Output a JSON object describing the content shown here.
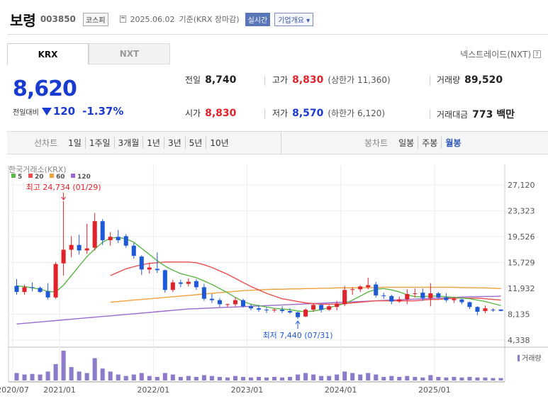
{
  "header": {
    "name": "보령",
    "code": "003850",
    "market": "코스피",
    "date": "2025.06.02",
    "basis": "기준(KRX 장마감)",
    "realtime": "실시간",
    "overview": "기업개요 ▾"
  },
  "tabs": [
    "KRX",
    "NXT"
  ],
  "nxt_link": "넥스트레이드(NXT)",
  "price": {
    "current": "8,620",
    "change_label": "전일대비",
    "change": "120",
    "change_pct": "-1.37%"
  },
  "stats": {
    "prev_label": "전일",
    "prev": "8,740",
    "high_label": "고가",
    "high": "8,830",
    "upper_limit": "(상한가 11,360)",
    "volume_label": "거래량",
    "volume": "89,520",
    "open_label": "시가",
    "open": "8,830",
    "low_label": "저가",
    "low": "8,570",
    "lower_limit": "(하한가 6,120)",
    "value_label": "거래대금",
    "value": "773 백만"
  },
  "toolbar": {
    "line_label": "선차트",
    "line_items": [
      "1일",
      "1주일",
      "3개월",
      "1년",
      "3년",
      "5년",
      "10년"
    ],
    "candle_label": "봉차트",
    "candle_items": [
      "일봉",
      "주봉",
      "월봉"
    ],
    "active_candle": "월봉"
  },
  "colors": {
    "up": "#e0222a",
    "down": "#1f5ad6",
    "ma5": "#5cb848",
    "ma20": "#e8504f",
    "ma60": "#f0a23c",
    "ma120": "#9b6bd0",
    "volume": "#8b7bc9"
  },
  "chart_data": {
    "type": "candlestick",
    "source_label": "한국거래소(KRX)",
    "legend": [
      {
        "name": "5",
        "color": "#5cb848"
      },
      {
        "name": "20",
        "color": "#e8504f"
      },
      {
        "name": "60",
        "color": "#f0a23c"
      },
      {
        "name": "120",
        "color": "#9b6bd0"
      }
    ],
    "y_ticks": [
      "27,120",
      "23,323",
      "19,526",
      "15,729",
      "11,932",
      "8,135",
      "4,338"
    ],
    "ylim": [
      4338,
      27120
    ],
    "x_ticks": [
      "2020/07",
      "2021/01",
      "2022/01",
      "2023/01",
      "2024/01",
      "2025/01"
    ],
    "x_tick_index": [
      0,
      6,
      18,
      30,
      42,
      54
    ],
    "max_label": "최고 24,734 (01/29)",
    "max_index": 6,
    "max_value": 24734,
    "min_label": "최저 7,440 (07/31)",
    "min_index": 36,
    "min_value": 7440,
    "volume_label": "거래량",
    "candles": [
      {
        "o": 12300,
        "h": 13300,
        "l": 11000,
        "c": 11400
      },
      {
        "o": 11400,
        "h": 12500,
        "l": 11000,
        "c": 12100
      },
      {
        "o": 12100,
        "h": 12800,
        "l": 11500,
        "c": 12000
      },
      {
        "o": 12000,
        "h": 12200,
        "l": 11300,
        "c": 11400
      },
      {
        "o": 11500,
        "h": 12700,
        "l": 10300,
        "c": 10600
      },
      {
        "o": 10600,
        "h": 15800,
        "l": 10400,
        "c": 15500
      },
      {
        "o": 15600,
        "h": 24734,
        "l": 13800,
        "c": 17600
      },
      {
        "o": 17600,
        "h": 19600,
        "l": 16500,
        "c": 18300
      },
      {
        "o": 18300,
        "h": 19800,
        "l": 16900,
        "c": 17500
      },
      {
        "o": 17500,
        "h": 21400,
        "l": 17000,
        "c": 17800
      },
      {
        "o": 17900,
        "h": 23000,
        "l": 17500,
        "c": 21800
      },
      {
        "o": 21800,
        "h": 22100,
        "l": 18300,
        "c": 19000
      },
      {
        "o": 19000,
        "h": 20200,
        "l": 18200,
        "c": 19500
      },
      {
        "o": 19500,
        "h": 20500,
        "l": 18600,
        "c": 19000
      },
      {
        "o": 19600,
        "h": 19900,
        "l": 17900,
        "c": 18200
      },
      {
        "o": 18200,
        "h": 18600,
        "l": 16300,
        "c": 16700
      },
      {
        "o": 16600,
        "h": 16800,
        "l": 13900,
        "c": 14700
      },
      {
        "o": 14700,
        "h": 15700,
        "l": 14100,
        "c": 15000
      },
      {
        "o": 14800,
        "h": 17200,
        "l": 14200,
        "c": 14600
      },
      {
        "o": 14600,
        "h": 14700,
        "l": 11300,
        "c": 11700
      },
      {
        "o": 11700,
        "h": 13200,
        "l": 11400,
        "c": 12800
      },
      {
        "o": 12800,
        "h": 13200,
        "l": 12100,
        "c": 12600
      },
      {
        "o": 12600,
        "h": 13400,
        "l": 12200,
        "c": 12900
      },
      {
        "o": 13000,
        "h": 13300,
        "l": 11700,
        "c": 12100
      },
      {
        "o": 12100,
        "h": 12600,
        "l": 10100,
        "c": 10400
      },
      {
        "o": 10400,
        "h": 11100,
        "l": 9800,
        "c": 10200
      },
      {
        "o": 10200,
        "h": 10500,
        "l": 9200,
        "c": 9600
      },
      {
        "o": 9600,
        "h": 9700,
        "l": 9200,
        "c": 9600
      },
      {
        "o": 9600,
        "h": 10600,
        "l": 9300,
        "c": 10200
      },
      {
        "o": 10200,
        "h": 10400,
        "l": 9100,
        "c": 9300
      },
      {
        "o": 9300,
        "h": 9600,
        "l": 8700,
        "c": 9000
      },
      {
        "o": 9000,
        "h": 9500,
        "l": 8500,
        "c": 8800
      },
      {
        "o": 8800,
        "h": 9100,
        "l": 8300,
        "c": 8700
      },
      {
        "o": 8700,
        "h": 9000,
        "l": 8400,
        "c": 8800
      },
      {
        "o": 8800,
        "h": 9300,
        "l": 8300,
        "c": 8600
      },
      {
        "o": 8600,
        "h": 9000,
        "l": 8200,
        "c": 8400
      },
      {
        "o": 8400,
        "h": 8500,
        "l": 7440,
        "c": 7700
      },
      {
        "o": 7800,
        "h": 9000,
        "l": 7700,
        "c": 8800
      },
      {
        "o": 8800,
        "h": 9700,
        "l": 8500,
        "c": 9500
      },
      {
        "o": 9500,
        "h": 9600,
        "l": 8400,
        "c": 8800
      },
      {
        "o": 8800,
        "h": 9500,
        "l": 8600,
        "c": 9300
      },
      {
        "o": 9200,
        "h": 10100,
        "l": 8700,
        "c": 9700
      },
      {
        "o": 9600,
        "h": 12300,
        "l": 9300,
        "c": 11700
      },
      {
        "o": 11700,
        "h": 12100,
        "l": 11000,
        "c": 11800
      },
      {
        "o": 11800,
        "h": 12400,
        "l": 11400,
        "c": 12200
      },
      {
        "o": 12100,
        "h": 13500,
        "l": 11800,
        "c": 12400
      },
      {
        "o": 12500,
        "h": 12900,
        "l": 10600,
        "c": 10900
      },
      {
        "o": 10900,
        "h": 11300,
        "l": 10400,
        "c": 10800
      },
      {
        "o": 10800,
        "h": 11000,
        "l": 9600,
        "c": 10000
      },
      {
        "o": 10000,
        "h": 10700,
        "l": 9800,
        "c": 10300
      },
      {
        "o": 10300,
        "h": 11800,
        "l": 9600,
        "c": 11100
      },
      {
        "o": 11100,
        "h": 11900,
        "l": 10600,
        "c": 11200
      },
      {
        "o": 11300,
        "h": 11900,
        "l": 10100,
        "c": 10500
      },
      {
        "o": 10500,
        "h": 12700,
        "l": 9300,
        "c": 11200
      },
      {
        "o": 11200,
        "h": 11400,
        "l": 10400,
        "c": 10600
      },
      {
        "o": 10600,
        "h": 11200,
        "l": 9900,
        "c": 10200
      },
      {
        "o": 10200,
        "h": 10700,
        "l": 9800,
        "c": 10400
      },
      {
        "o": 10300,
        "h": 10400,
        "l": 9600,
        "c": 9900
      },
      {
        "o": 9900,
        "h": 10000,
        "l": 8900,
        "c": 9200
      },
      {
        "o": 9200,
        "h": 9300,
        "l": 8000,
        "c": 8500
      },
      {
        "o": 8600,
        "h": 9400,
        "l": 8300,
        "c": 9000
      },
      {
        "o": 8800,
        "h": 9000,
        "l": 8500,
        "c": 8700
      },
      {
        "o": 8830,
        "h": 8830,
        "l": 8570,
        "c": 8620
      }
    ],
    "ma5": [
      12300,
      12200,
      12000,
      11800,
      11500,
      11400,
      12400,
      13800,
      15200,
      16600,
      17700,
      18700,
      19300,
      19400,
      19200,
      18700,
      17800,
      16900,
      16000,
      15200,
      14600,
      14100,
      13800,
      13500,
      13000,
      12500,
      11900,
      11300,
      10600,
      10000,
      9600,
      9400,
      9200,
      9000,
      8900,
      8800,
      8600,
      8500,
      8600,
      8800,
      9100,
      9400,
      9700,
      10200,
      10800,
      11400,
      11800,
      11900,
      11700,
      11400,
      11000,
      10700,
      10700,
      10800,
      10800,
      10700,
      10600,
      10500,
      10400,
      10200,
      10000,
      9700,
      9400
    ],
    "ma20": [
      null,
      null,
      null,
      null,
      null,
      null,
      null,
      null,
      null,
      null,
      null,
      null,
      13800,
      14300,
      14800,
      15100,
      15400,
      15600,
      15700,
      15800,
      15800,
      15800,
      15800,
      15700,
      15400,
      15000,
      14500,
      14000,
      13400,
      12800,
      12200,
      11700,
      11200,
      10800,
      10400,
      10200,
      10000,
      9800,
      9700,
      9600,
      9600,
      9600,
      9700,
      9800,
      9900,
      10000,
      10100,
      10100,
      10100,
      10100,
      10100,
      10100,
      10200,
      10300,
      10300,
      10400,
      10500,
      10500,
      10500,
      10500,
      10400,
      10300,
      10200
    ],
    "ma60": [
      null,
      null,
      null,
      null,
      null,
      null,
      null,
      null,
      null,
      null,
      null,
      null,
      9900,
      10000,
      10100,
      10200,
      10300,
      10400,
      10500,
      10600,
      10700,
      10800,
      10900,
      11000,
      11100,
      11200,
      11300,
      11400,
      11500,
      11600,
      11650,
      11700,
      11750,
      11800,
      11800,
      11850,
      11850,
      11900,
      11900,
      11950,
      11950,
      12000,
      12000,
      12000,
      12050,
      12050,
      12050,
      12100,
      12100,
      12100,
      12100,
      12100,
      12100,
      12100,
      12100,
      12100,
      12100,
      12050,
      12050,
      12000,
      12000,
      11950,
      11900
    ],
    "ma120": [
      6700,
      6800,
      6900,
      7000,
      7100,
      7200,
      7300,
      7400,
      7500,
      7600,
      7700,
      7800,
      7900,
      8000,
      8100,
      8200,
      8300,
      8400,
      8500,
      8600,
      8700,
      8800,
      8900,
      8950,
      9000,
      9050,
      9100,
      9150,
      9200,
      9250,
      9300,
      9350,
      9400,
      9450,
      9500,
      9550,
      9600,
      9650,
      9700,
      9750,
      9800,
      9850,
      9900,
      9950,
      10000,
      10050,
      10100,
      10150,
      10200,
      10250,
      10300,
      10350,
      10400,
      10450,
      10500,
      10550,
      10600,
      10650,
      10700,
      10700,
      10750,
      10750,
      10800
    ],
    "volume": [
      0.25,
      0.2,
      0.22,
      0.2,
      0.3,
      0.55,
      1.0,
      0.45,
      0.3,
      0.25,
      0.75,
      0.4,
      0.3,
      0.2,
      0.15,
      0.2,
      0.25,
      0.15,
      0.12,
      0.25,
      0.2,
      0.12,
      0.15,
      0.12,
      0.18,
      0.15,
      0.12,
      0.1,
      0.15,
      0.12,
      0.1,
      0.12,
      0.1,
      0.12,
      0.1,
      0.12,
      0.2,
      0.25,
      0.2,
      0.15,
      0.15,
      0.2,
      0.3,
      0.25,
      0.2,
      0.25,
      0.2,
      0.12,
      0.15,
      0.12,
      0.15,
      0.12,
      0.1,
      0.18,
      0.12,
      0.1,
      0.12,
      0.1,
      0.12,
      0.1,
      0.1,
      0.08,
      0.08
    ]
  }
}
